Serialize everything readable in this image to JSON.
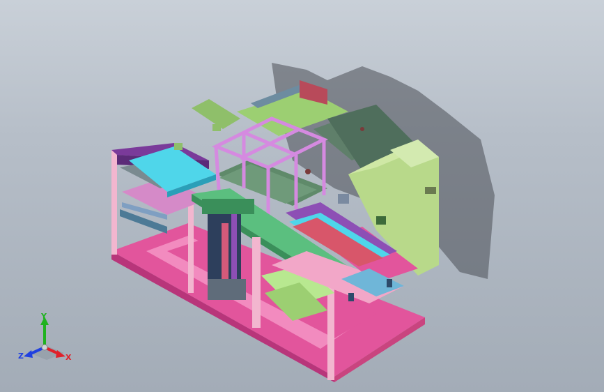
{
  "triad": {
    "x_label": "X",
    "y_label": "Y",
    "z_label": "Z"
  },
  "colors": {
    "background_top": "#c9d0d8",
    "background_bottom": "#a3acb7",
    "frame_pink": "#e2559c",
    "panel_green": "#b8d98a",
    "cyan_plate": "#4fd6ea",
    "purple": "#8d4fb5",
    "magenta_frame": "#d58ae0",
    "x_axis": "#e0202a",
    "y_axis": "#1fb21f",
    "z_axis": "#2040e0"
  }
}
